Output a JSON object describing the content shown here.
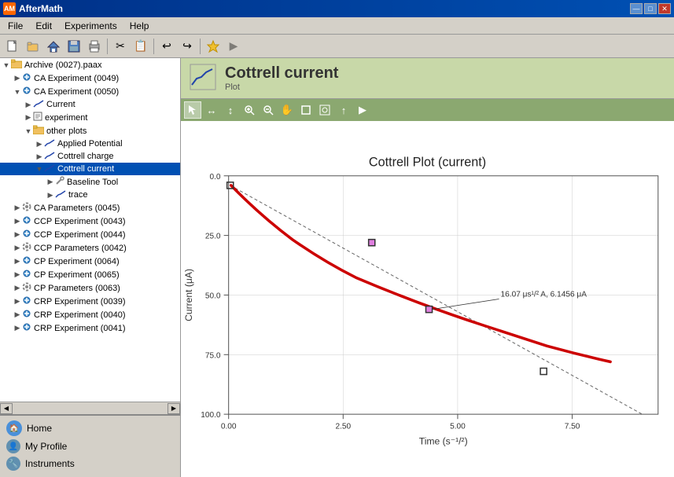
{
  "app": {
    "title": "AfterMath",
    "title_icon": "AM"
  },
  "title_bar": {
    "buttons": [
      "—",
      "□",
      "✕"
    ]
  },
  "menu": {
    "items": [
      "File",
      "Edit",
      "Experiments",
      "Help"
    ]
  },
  "header": {
    "title": "Cottrell current",
    "subtitle": "Plot"
  },
  "tree": {
    "nodes": [
      {
        "id": "archive",
        "label": "Archive (0027).paax",
        "indent": 0,
        "expanded": true,
        "icon": "📁"
      },
      {
        "id": "ca0049",
        "label": "CA Experiment (0049)",
        "indent": 1,
        "expanded": false,
        "icon": "🔬"
      },
      {
        "id": "ca0050",
        "label": "CA Experiment (0050)",
        "indent": 1,
        "expanded": true,
        "icon": "🔬"
      },
      {
        "id": "current",
        "label": "Current",
        "indent": 2,
        "expanded": false,
        "icon": "📈"
      },
      {
        "id": "experiment",
        "label": "experiment",
        "indent": 2,
        "expanded": false,
        "icon": "📋"
      },
      {
        "id": "otherplots",
        "label": "other plots",
        "indent": 2,
        "expanded": true,
        "icon": "📁"
      },
      {
        "id": "applied",
        "label": "Applied Potential",
        "indent": 3,
        "expanded": false,
        "icon": "📈"
      },
      {
        "id": "cottcharge",
        "label": "Cottrell charge",
        "indent": 3,
        "expanded": false,
        "icon": "📈"
      },
      {
        "id": "cottcurrent",
        "label": "Cottrell current",
        "indent": 3,
        "expanded": true,
        "icon": "📈",
        "selected": true
      },
      {
        "id": "baseline",
        "label": "Baseline Tool",
        "indent": 4,
        "expanded": false,
        "icon": "🔧"
      },
      {
        "id": "trace",
        "label": "trace",
        "indent": 4,
        "expanded": false,
        "icon": "📈"
      },
      {
        "id": "caparams",
        "label": "CA Parameters (0045)",
        "indent": 1,
        "expanded": false,
        "icon": "⚙️"
      },
      {
        "id": "ccp0043",
        "label": "CCP Experiment (0043)",
        "indent": 1,
        "expanded": false,
        "icon": "🔬"
      },
      {
        "id": "ccp0044",
        "label": "CCP Experiment (0044)",
        "indent": 1,
        "expanded": false,
        "icon": "🔬"
      },
      {
        "id": "ccpparams",
        "label": "CCP Parameters (0042)",
        "indent": 1,
        "expanded": false,
        "icon": "⚙️"
      },
      {
        "id": "cp0064",
        "label": "CP Experiment (0064)",
        "indent": 1,
        "expanded": false,
        "icon": "🔬"
      },
      {
        "id": "cp0065",
        "label": "CP Experiment (0065)",
        "indent": 1,
        "expanded": false,
        "icon": "🔬"
      },
      {
        "id": "cpparams",
        "label": "CP Parameters (0063)",
        "indent": 1,
        "expanded": false,
        "icon": "⚙️"
      },
      {
        "id": "crp0039",
        "label": "CRP Experiment (0039)",
        "indent": 1,
        "expanded": false,
        "icon": "🔬"
      },
      {
        "id": "crp0040",
        "label": "CRP Experiment (0040)",
        "indent": 1,
        "expanded": false,
        "icon": "🔬"
      },
      {
        "id": "crp0041",
        "label": "CRP Experiment (0041)",
        "indent": 1,
        "expanded": false,
        "icon": "🔬"
      }
    ]
  },
  "bottom_nav": {
    "items": [
      {
        "id": "home",
        "label": "Home",
        "icon": "🏠"
      },
      {
        "id": "myprofile",
        "label": "My Profile",
        "icon": "👤"
      },
      {
        "id": "instruments",
        "label": "Instruments",
        "icon": "🔧"
      }
    ]
  },
  "plot": {
    "title": "Cottrell Plot (current)",
    "x_label": "Time (s⁻¹/²)",
    "y_label": "Current (μA)",
    "annotation": "16.07 μs¹/² A, 6.1456 μA",
    "x_ticks": [
      "0.00",
      "2.50",
      "5.00",
      "7.50"
    ],
    "y_ticks": [
      "0.0",
      "25.0",
      "50.0",
      "75.0",
      "100.0"
    ]
  },
  "plot_toolbar": {
    "tools": [
      "↖",
      "↔",
      "↕",
      "🔍+",
      "🔍-",
      "✋",
      "□",
      "⊡",
      "↑",
      "▶"
    ]
  },
  "colors": {
    "accent": "#0050b3",
    "header_bg": "#c8d8a8",
    "toolbar_bg": "#8ba870",
    "selected": "#0050b3",
    "curve_red": "#cc0000",
    "dashed_line": "#555555"
  }
}
